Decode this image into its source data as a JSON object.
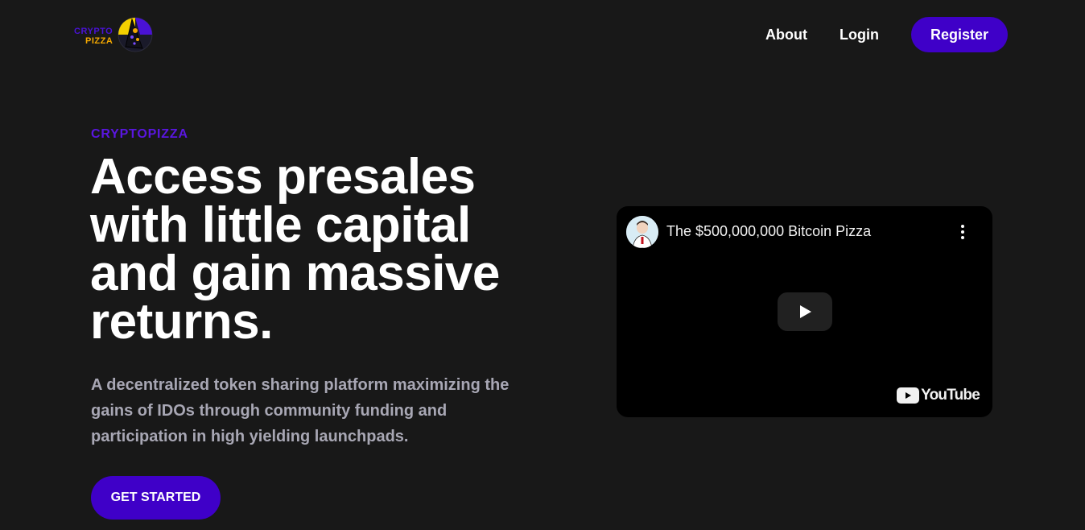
{
  "header": {
    "logo": {
      "line1": "CRYPTO",
      "line2": "PIZZA"
    },
    "nav": {
      "about": "About",
      "login": "Login",
      "register": "Register"
    }
  },
  "hero": {
    "eyebrow": "CRYPTOPIZZA",
    "headline": "Access presales with little capital and gain massive returns.",
    "subtext": "A decentralized token sharing platform maximizing the gains of IDOs through community funding and participation in high yielding launchpads.",
    "cta": "GET STARTED"
  },
  "video": {
    "title": "The $500,000,000 Bitcoin Pizza",
    "brand": "YouTube"
  },
  "colors": {
    "background": "#181818",
    "accent": "#3f00c8",
    "eyebrow": "#5a16e0",
    "logo_yellow": "#f4a800",
    "subtext": "#a8a7b4"
  },
  "icons": [
    "logo-mark-icon",
    "kebab-menu-icon",
    "play-icon",
    "youtube-icon"
  ]
}
